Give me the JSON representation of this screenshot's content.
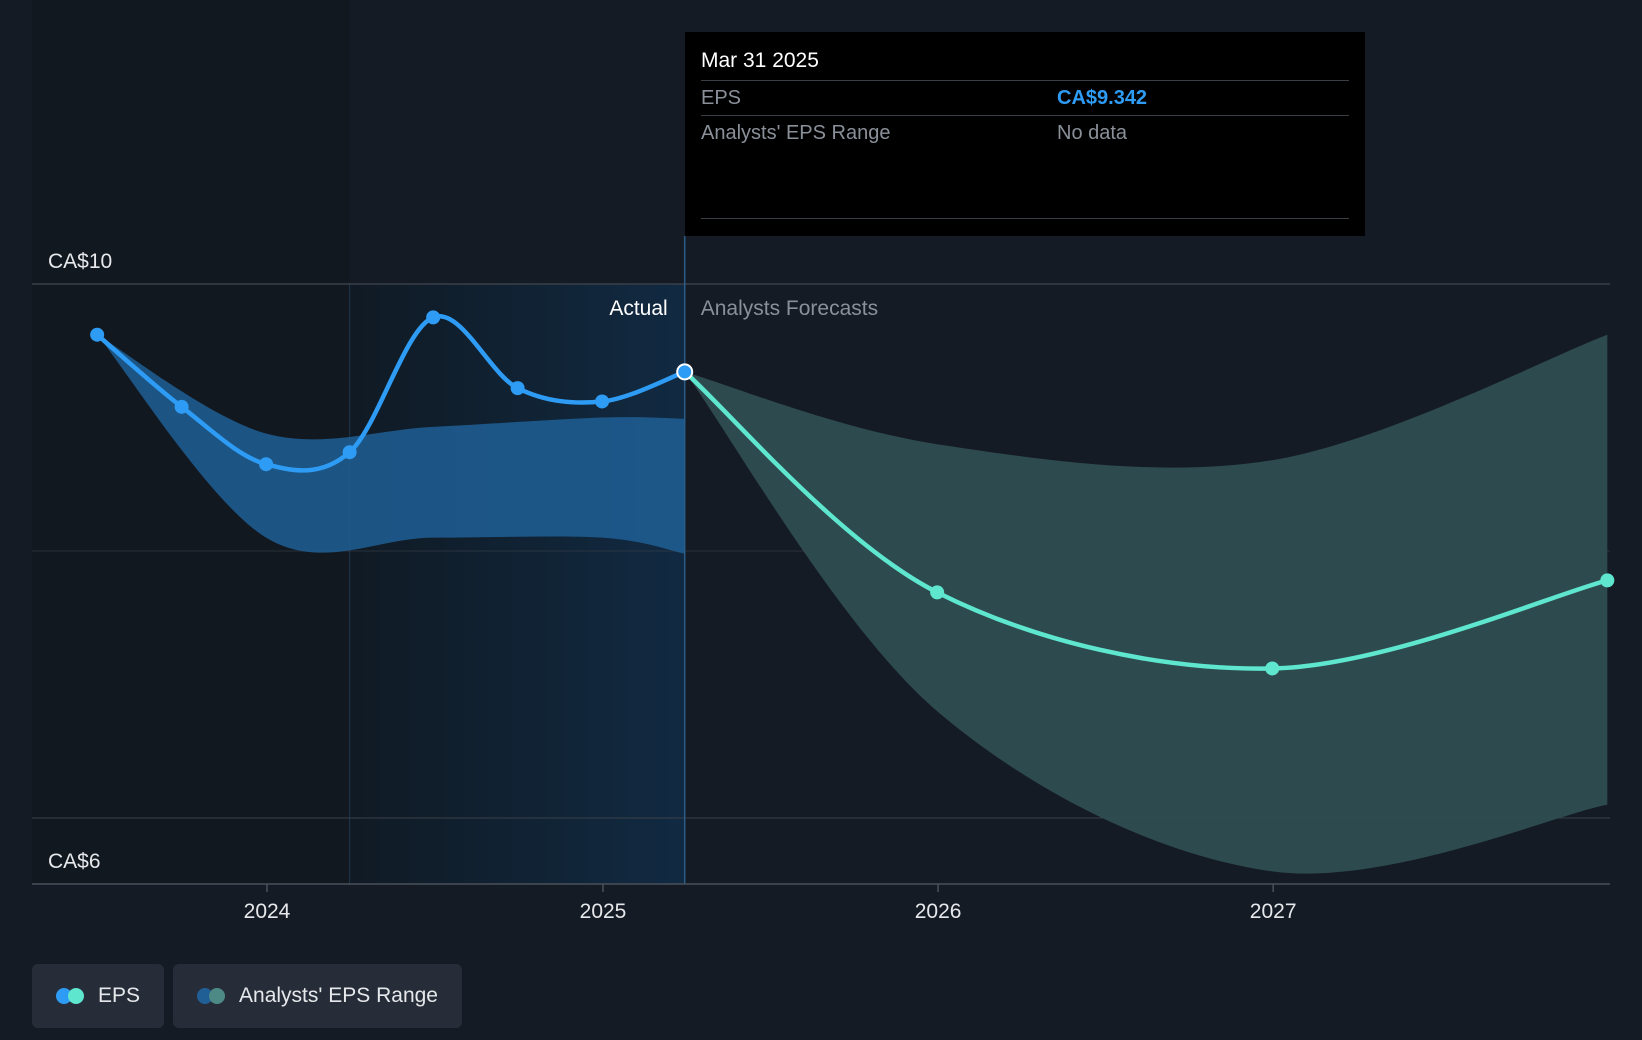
{
  "chart_data": {
    "type": "line",
    "x_ticks": [
      "2024",
      "2025",
      "2026",
      "2027"
    ],
    "y_ticks": [
      "CA$10",
      "CA$6"
    ],
    "ylim": [
      6,
      10
    ],
    "grid": true,
    "region_labels": {
      "actual": "Actual",
      "forecast": "Analysts Forecasts"
    },
    "series": [
      {
        "name": "EPS",
        "role": "actual",
        "points": [
          {
            "x": "2023-06-30",
            "y": 9.62
          },
          {
            "x": "2023-09-30",
            "y": 9.08
          },
          {
            "x": "2023-12-31",
            "y": 8.65
          },
          {
            "x": "2024-03-31",
            "y": 8.74
          },
          {
            "x": "2024-06-30",
            "y": 9.75
          },
          {
            "x": "2024-09-30",
            "y": 9.22
          },
          {
            "x": "2024-12-31",
            "y": 9.12
          },
          {
            "x": "2025-03-31",
            "y": 9.342
          }
        ]
      },
      {
        "name": "EPS",
        "role": "forecast",
        "points": [
          {
            "x": "2025-03-31",
            "y": 9.342
          },
          {
            "x": "2025-12-31",
            "y": 7.69
          },
          {
            "x": "2026-12-31",
            "y": 7.12
          },
          {
            "x": "2027-12-31",
            "y": 7.78
          }
        ]
      },
      {
        "name": "Analysts' EPS Range",
        "role": "range-actual",
        "upper": [
          {
            "x": "2023-06-30",
            "y": 9.62
          },
          {
            "x": "2023-12-31",
            "y": 8.88
          },
          {
            "x": "2024-06-30",
            "y": 8.93
          },
          {
            "x": "2024-12-31",
            "y": 9.0
          },
          {
            "x": "2025-03-31",
            "y": 8.99
          }
        ],
        "lower": [
          {
            "x": "2023-06-30",
            "y": 9.62
          },
          {
            "x": "2023-12-31",
            "y": 8.1
          },
          {
            "x": "2024-06-30",
            "y": 8.1
          },
          {
            "x": "2024-12-31",
            "y": 8.1
          },
          {
            "x": "2025-03-31",
            "y": 7.98
          }
        ]
      },
      {
        "name": "Analysts' EPS Range",
        "role": "range-forecast",
        "upper": [
          {
            "x": "2025-03-31",
            "y": 9.342
          },
          {
            "x": "2025-12-31",
            "y": 8.8
          },
          {
            "x": "2026-12-31",
            "y": 8.68
          },
          {
            "x": "2027-12-31",
            "y": 9.62
          }
        ],
        "lower": [
          {
            "x": "2025-03-31",
            "y": 9.342
          },
          {
            "x": "2025-12-31",
            "y": 6.8
          },
          {
            "x": "2026-12-31",
            "y": 5.6
          },
          {
            "x": "2027-12-31",
            "y": 6.1
          }
        ]
      }
    ],
    "colors": {
      "background": "#151b24",
      "eps_actual": "#2e9cf4",
      "eps_forecast": "#5ee6cf",
      "range_actual": "#1f5f95",
      "range_forecast": "#2e4d51",
      "highlight": "#112a42",
      "grid": "#3a4049"
    }
  },
  "tooltip": {
    "date": "Mar 31 2025",
    "rows": [
      {
        "label": "EPS",
        "value": "CA$9.342"
      },
      {
        "label": "Analysts' EPS Range",
        "value": "No data"
      }
    ]
  },
  "legend": {
    "items": [
      {
        "label": "EPS",
        "colors": [
          "#2e9cf4",
          "#5ee6cf"
        ]
      },
      {
        "label": "Analysts' EPS Range",
        "colors": [
          "#1f5f95",
          "#4d8a86"
        ]
      }
    ]
  }
}
